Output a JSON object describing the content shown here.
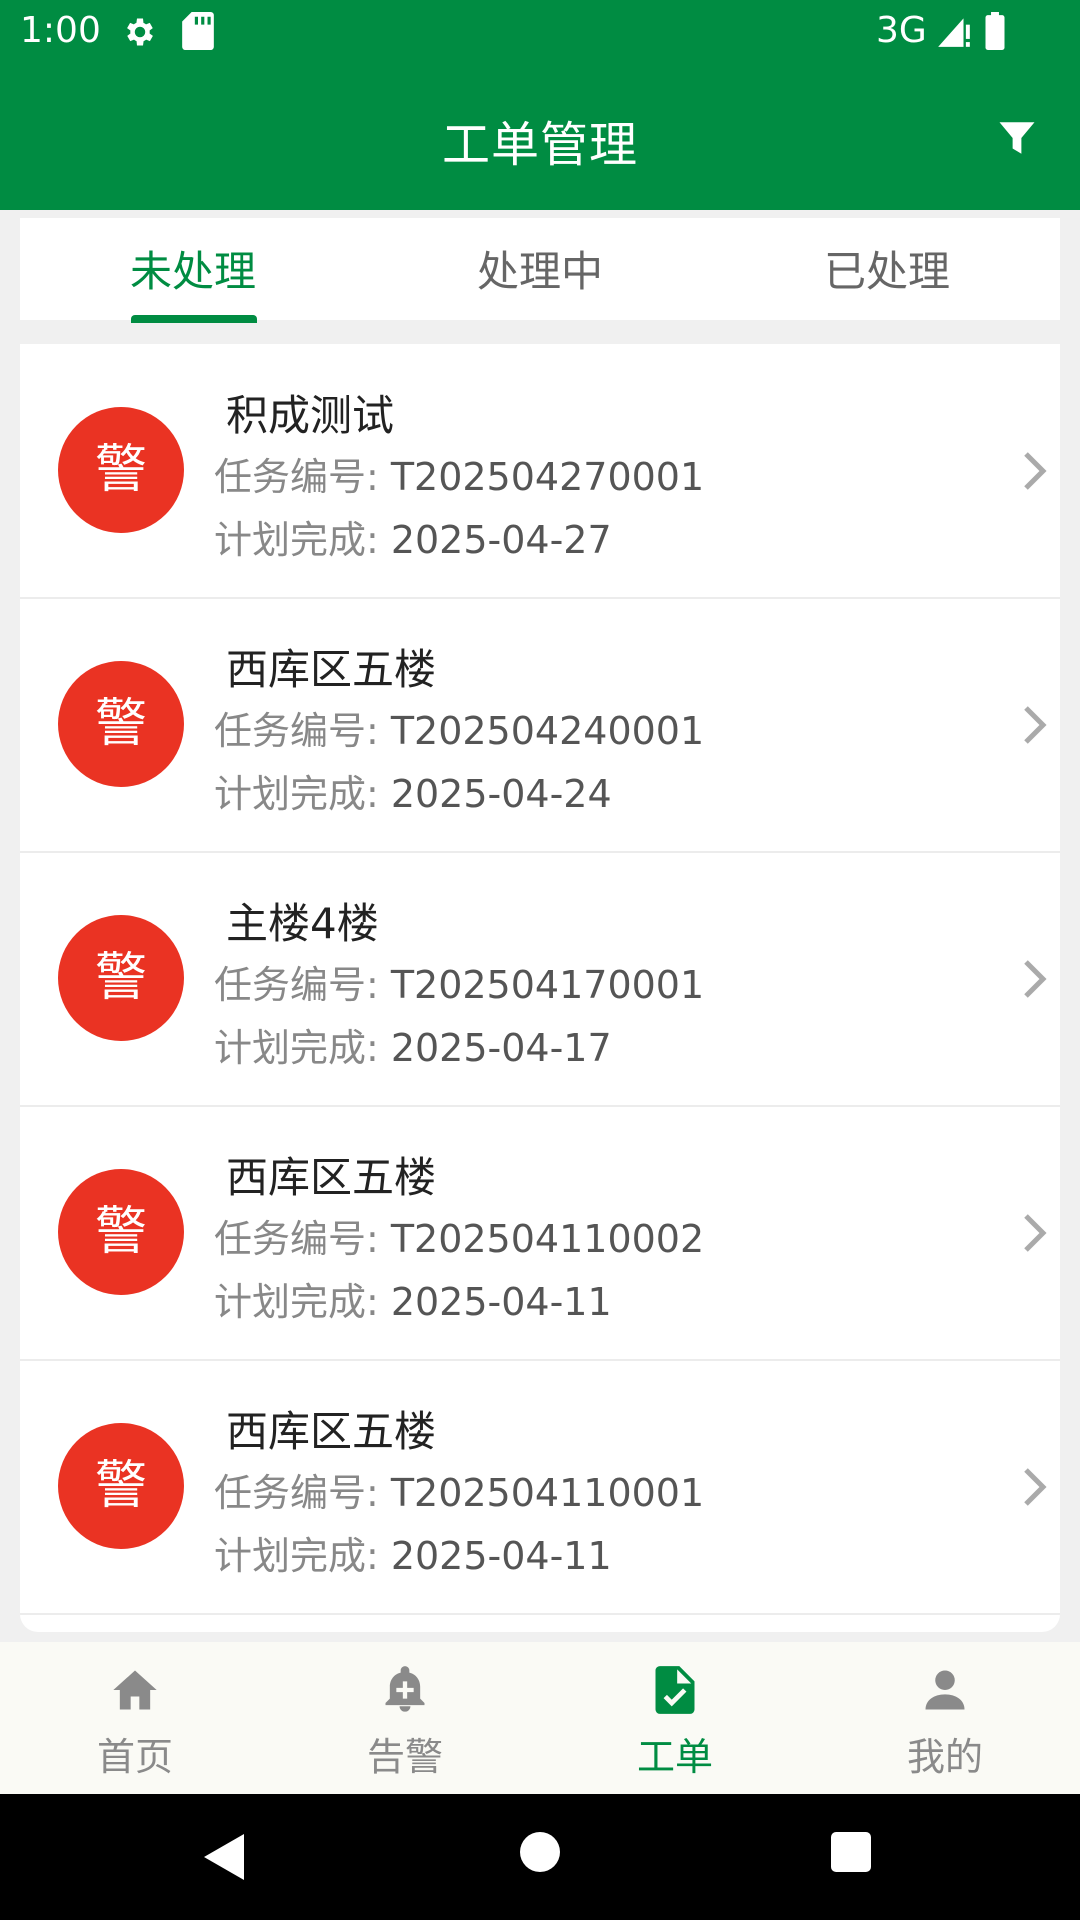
{
  "status_bar": {
    "time": "1:00",
    "network": "3G",
    "icons": [
      "gear-icon",
      "sd-card-icon",
      "signal-icon",
      "battery-icon"
    ]
  },
  "app_bar": {
    "title": "工单管理",
    "filter_icon": "filter-icon"
  },
  "tabs": [
    {
      "label": "未处理",
      "active": true
    },
    {
      "label": "处理中",
      "active": false
    },
    {
      "label": "已处理",
      "active": false
    }
  ],
  "work_orders": [
    {
      "badge": "警",
      "title": "积成测试",
      "task_label": "任务编号:",
      "task_no": "T202504270001",
      "plan_label": "计划完成:",
      "plan_date": "2025-04-27"
    },
    {
      "badge": "警",
      "title": "西库区五楼",
      "task_label": "任务编号:",
      "task_no": "T202504240001",
      "plan_label": "计划完成:",
      "plan_date": "2025-04-24"
    },
    {
      "badge": "警",
      "title": "主楼4楼",
      "task_label": "任务编号:",
      "task_no": "T202504170001",
      "plan_label": "计划完成:",
      "plan_date": "2025-04-17"
    },
    {
      "badge": "警",
      "title": "西库区五楼",
      "task_label": "任务编号:",
      "task_no": "T202504110002",
      "plan_label": "计划完成:",
      "plan_date": "2025-04-11"
    },
    {
      "badge": "警",
      "title": "西库区五楼",
      "task_label": "任务编号:",
      "task_no": "T202504110001",
      "plan_label": "计划完成:",
      "plan_date": "2025-04-11"
    }
  ],
  "bottom_nav": [
    {
      "label": "首页",
      "icon": "home-icon",
      "active": false
    },
    {
      "label": "告警",
      "icon": "alarm-bell-icon",
      "active": false
    },
    {
      "label": "工单",
      "icon": "work-order-icon",
      "active": true
    },
    {
      "label": "我的",
      "icon": "profile-icon",
      "active": false
    }
  ],
  "colors": {
    "brand": "#008c42",
    "alert_badge": "#ea3323",
    "inactive": "#8a8a8a"
  }
}
